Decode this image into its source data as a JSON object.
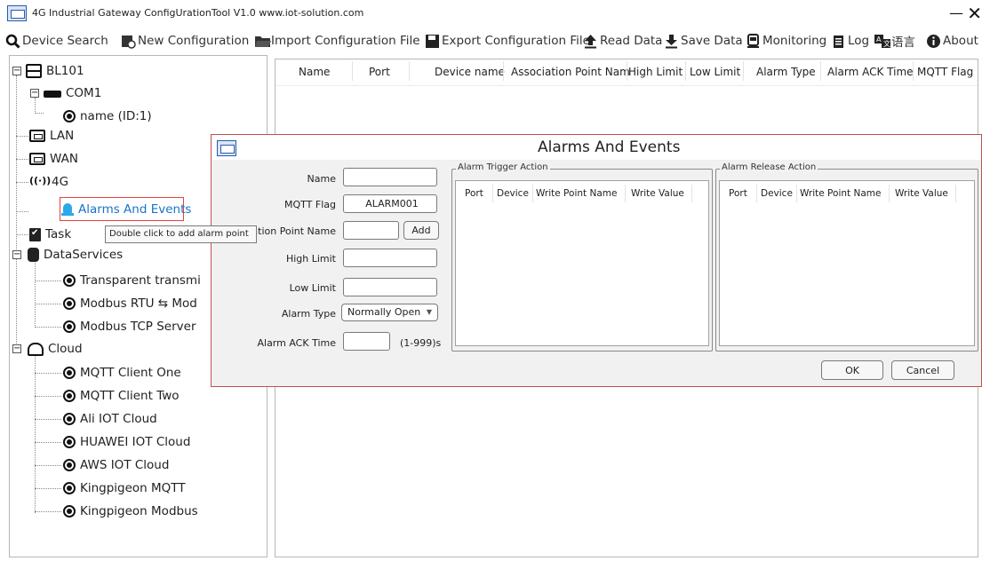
{
  "window": {
    "title": "4G Industrial Gateway ConfigUrationTool V1.0 www.iot-solution.com",
    "minimize": "—",
    "close": "✕"
  },
  "toolbar": {
    "device_search": "Device Search",
    "new_configuration": "New Configuration",
    "import_configuration": "Import Configuration File",
    "export_configuration": "Export Configuration File",
    "read_data": "Read Data",
    "save_data": "Save Data",
    "monitoring": "Monitoring",
    "log": "Log",
    "language": "语言",
    "about": "About"
  },
  "tree": {
    "root": "BL101",
    "com1": "COM1",
    "com1_child": "name  (ID:1)",
    "lan": "LAN",
    "wan": "WAN",
    "fourg": "4G",
    "alarms": "Alarms And Events",
    "task": "Task",
    "dataservices": "DataServices",
    "transparent": "Transparent transmi",
    "modbus_rtu": "Modbus RTU ⇆ Mod",
    "modbus_tcp": "Modbus TCP Server",
    "cloud": "Cloud",
    "mqtt_one": "MQTT Client One",
    "mqtt_two": "MQTT Client Two",
    "ali": "Ali IOT Cloud",
    "huawei": "HUAWEI IOT Cloud",
    "aws": "AWS IOT Cloud",
    "kp_mqtt": "Kingpigeon MQTT",
    "kp_modbus": "Kingpigeon Modbus"
  },
  "tooltip": "Double click to add alarm point",
  "grid": {
    "columns": [
      "Name",
      "Port",
      "Device name",
      "Association Point Nam",
      "High Limit",
      "Low Limit",
      "Alarm Type",
      "Alarm ACK Time",
      "MQTT Flag"
    ]
  },
  "dialog": {
    "title": "Alarms And Events",
    "name_label": "Name",
    "name_value": "",
    "mqtt_label": "MQTT Flag",
    "mqtt_value": "ALARM001",
    "assoc_label": "ation Point Name",
    "assoc_value": "",
    "add_button": "Add",
    "high_label": "High Limit",
    "high_value": "",
    "low_label": "Low Limit",
    "low_value": "",
    "type_label": "Alarm Type",
    "type_value": "Normally Open",
    "ack_label": "Alarm ACK Time",
    "ack_value": "",
    "ack_hint": "(1-999)s",
    "trigger_group": "Alarm Trigger Action",
    "release_group": "Alarm Release Action",
    "action_columns": [
      "Port",
      "Device",
      "Write Point Name",
      "Write Value"
    ],
    "ok": "OK",
    "cancel": "Cancel"
  }
}
